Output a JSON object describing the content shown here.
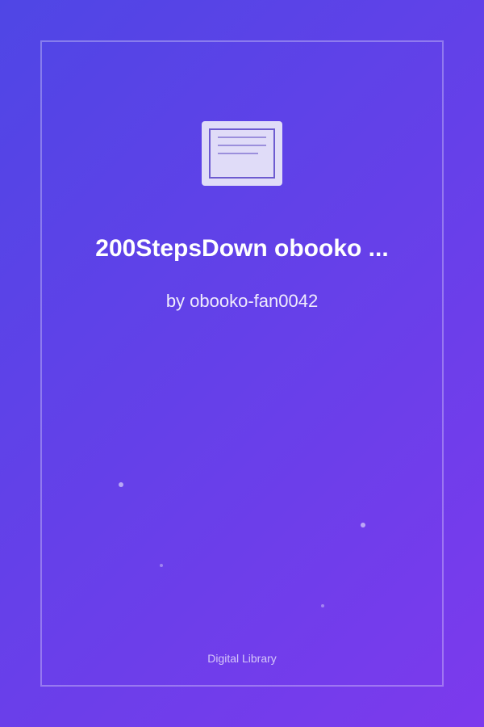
{
  "cover": {
    "title": "200StepsDown obooko ...",
    "author": "by obooko-fan0042",
    "footer": "Digital Library"
  },
  "colors": {
    "gradient_start": "#4f46e5",
    "gradient_end": "#7c3aed",
    "icon_fill": "#e0dcf8",
    "icon_stroke": "#6d5bd0"
  },
  "icons": {
    "cover_icon": "book-icon"
  }
}
